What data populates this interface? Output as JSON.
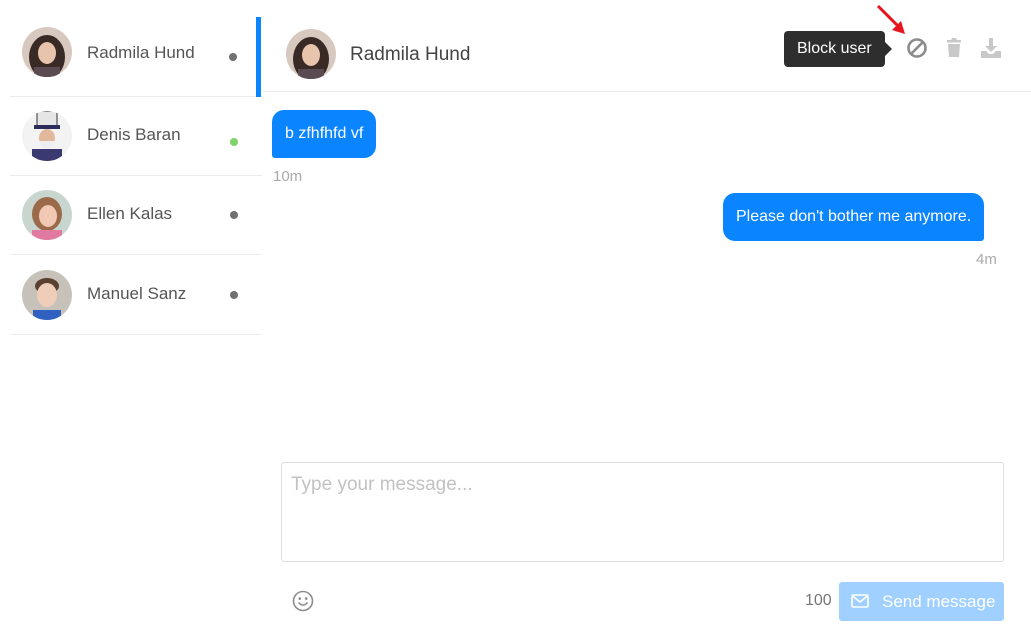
{
  "contacts": [
    {
      "name": "Radmila Hund",
      "status": "offline"
    },
    {
      "name": "Denis Baran",
      "status": "online"
    },
    {
      "name": "Ellen Kalas",
      "status": "offline"
    },
    {
      "name": "Manuel Sanz",
      "status": "offline"
    }
  ],
  "header": {
    "name": "Radmila Hund",
    "tooltip": "Block user",
    "actions": [
      "block-icon",
      "trash-icon",
      "download-icon"
    ]
  },
  "messages": [
    {
      "direction": "incoming",
      "text": "b zfhfhfd vf",
      "time": "10m"
    },
    {
      "direction": "outgoing",
      "text": "Please don't bother me anymore.",
      "time": "4m"
    }
  ],
  "composer": {
    "placeholder": "Type your message...",
    "char_count": "100",
    "send_label": "Send message"
  },
  "colors": {
    "accent": "#0a84ff",
    "online": "#7ed36a",
    "offline": "#707070",
    "send_disabled": "#9fd0ff",
    "annotation_arrow": "#e8141b"
  }
}
